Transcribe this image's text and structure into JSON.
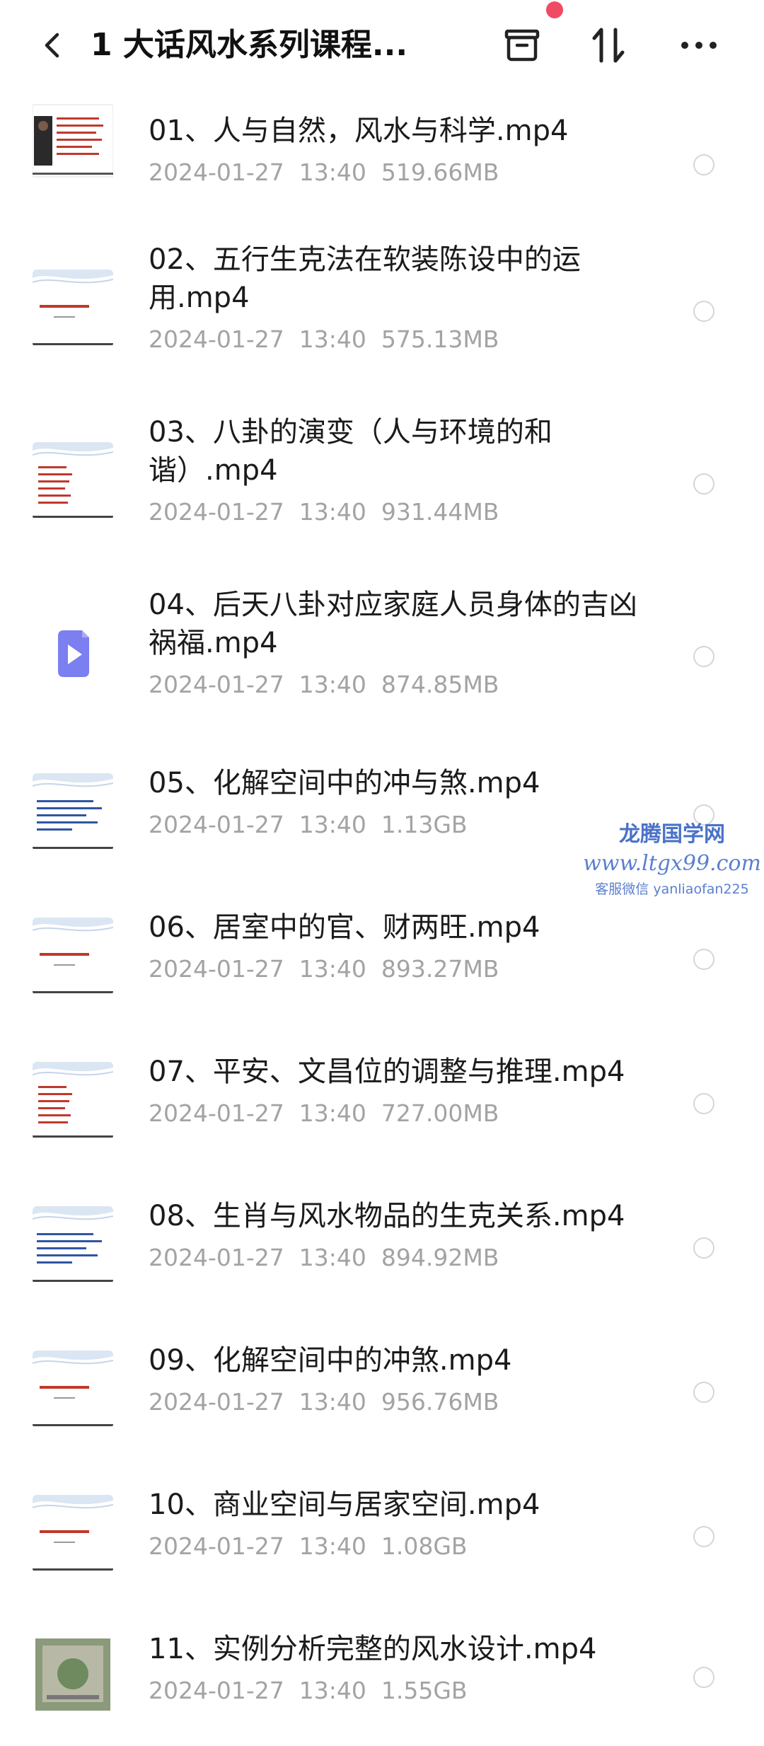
{
  "header": {
    "title": "1 大话风水系列课程...",
    "back_icon": "chevron-left-icon",
    "archive_icon": "archive-box-icon",
    "sort_icon": "sort-arrows-icon",
    "more_icon": "more-dots-icon",
    "notification_color": "#ef4b63"
  },
  "files": [
    {
      "name": "01、人与自然，风水与科学.mp4",
      "date": "2024-01-27",
      "time": "13:40",
      "size": "519.66MB",
      "thumb": "photo-slide"
    },
    {
      "name": "02、五行生克法在软装陈设中的运用.mp4",
      "date": "2024-01-27",
      "time": "13:40",
      "size": "575.13MB",
      "thumb": "title-slide"
    },
    {
      "name": "03、八卦的演变（人与环境的和谐）.mp4",
      "date": "2024-01-27",
      "time": "13:40",
      "size": "931.44MB",
      "thumb": "list-slide"
    },
    {
      "name": "04、后天八卦对应家庭人员身体的吉凶祸福.mp4",
      "date": "2024-01-27",
      "time": "13:40",
      "size": "874.85MB",
      "thumb": "video-icon"
    },
    {
      "name": "05、化解空间中的冲与煞.mp4",
      "date": "2024-01-27",
      "time": "13:40",
      "size": "1.13GB",
      "thumb": "text-slide"
    },
    {
      "name": "06、居室中的官、财两旺.mp4",
      "date": "2024-01-27",
      "time": "13:40",
      "size": "893.27MB",
      "thumb": "title-slide"
    },
    {
      "name": "07、平安、文昌位的调整与推理.mp4",
      "date": "2024-01-27",
      "time": "13:40",
      "size": "727.00MB",
      "thumb": "list-slide"
    },
    {
      "name": "08、生肖与风水物品的生克关系.mp4",
      "date": "2024-01-27",
      "time": "13:40",
      "size": "894.92MB",
      "thumb": "text-slide"
    },
    {
      "name": "09、化解空间中的冲煞.mp4",
      "date": "2024-01-27",
      "time": "13:40",
      "size": "956.76MB",
      "thumb": "title-slide"
    },
    {
      "name": "10、商业空间与居家空间.mp4",
      "date": "2024-01-27",
      "time": "13:40",
      "size": "1.08GB",
      "thumb": "title-slide"
    },
    {
      "name": "11、实例分析完整的风水设计.mp4",
      "date": "2024-01-27",
      "time": "13:40",
      "size": "1.55GB",
      "thumb": "map-slide"
    }
  ],
  "watermark": {
    "line1": "龙腾国学网",
    "line2": "www.ltgx99.com",
    "line3": "客服微信 yanliaofan225"
  }
}
